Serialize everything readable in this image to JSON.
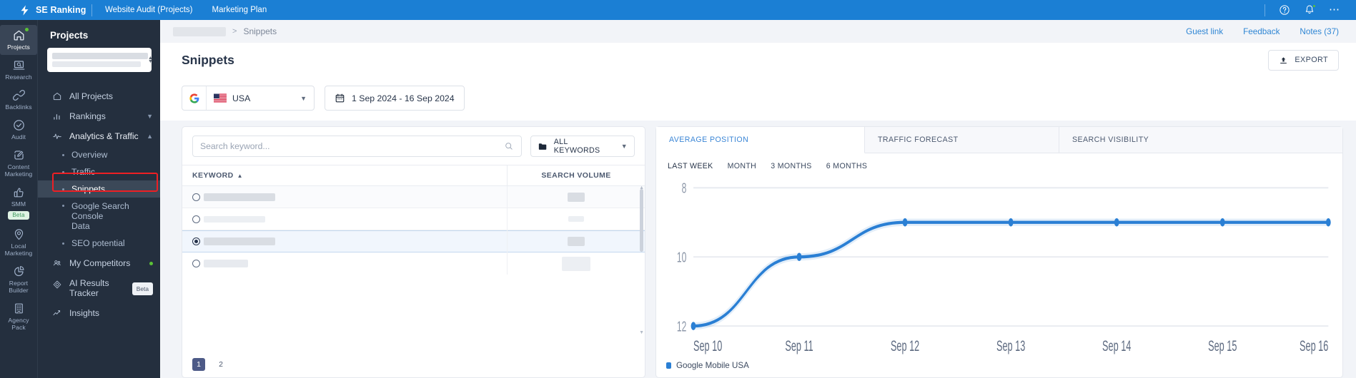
{
  "topbar": {
    "brand": "SE Ranking",
    "nav": [
      {
        "label": "Website Audit (Projects)"
      },
      {
        "label": "Marketing Plan"
      }
    ],
    "icons": {
      "help": "help-circle-icon",
      "notifications": "bell-icon",
      "more": "ellipsis-icon"
    }
  },
  "rail": {
    "items": [
      {
        "label": "Projects",
        "icon": "home-icon",
        "active": true,
        "dot": true
      },
      {
        "label": "Research",
        "icon": "research-magnifier-icon",
        "active": false,
        "dot": false
      },
      {
        "label": "Backlinks",
        "icon": "link-icon",
        "active": false,
        "dot": false
      },
      {
        "label": "Audit",
        "icon": "check-circle-icon",
        "active": false,
        "dot": false
      },
      {
        "label": "Content\nMarketing",
        "icon": "pencil-square-icon",
        "active": false,
        "dot": false
      },
      {
        "label": "SMM",
        "icon": "thumbs-up-icon",
        "active": false,
        "dot": false,
        "badge": "Beta"
      },
      {
        "label": "Local\nMarketing",
        "icon": "map-pin-icon",
        "active": false,
        "dot": false
      },
      {
        "label": "Report\nBuilder",
        "icon": "pie-chart-icon",
        "active": false,
        "dot": false
      },
      {
        "label": "Agency\nPack",
        "icon": "building-icon",
        "active": false,
        "dot": false
      }
    ],
    "labels": {
      "projects": "Projects",
      "research": "Research",
      "backlinks": "Backlinks",
      "audit": "Audit",
      "content_marketing_l1": "Content",
      "content_marketing_l2": "Marketing",
      "smm": "SMM",
      "smm_badge": "Beta",
      "local_marketing_l1": "Local",
      "local_marketing_l2": "Marketing",
      "report_builder_l1": "Report",
      "report_builder_l2": "Builder",
      "agency_pack_l1": "Agency",
      "agency_pack_l2": "Pack"
    }
  },
  "sidebar": {
    "title": "Projects",
    "project_selector_value": "",
    "nav": {
      "all_projects": "All Projects",
      "rankings": "Rankings",
      "analytics_traffic": "Analytics & Traffic",
      "overview": "Overview",
      "traffic": "Traffic",
      "snippets": "Snippets",
      "gsc_data_l1": "Google Search Console",
      "gsc_data_l2": "Data",
      "seo_potential": "SEO potential",
      "my_competitors": "My Competitors",
      "ai_results_l1": "AI Results",
      "ai_results_l2": "Tracker",
      "ai_results_badge": "Beta",
      "insights": "Insights"
    },
    "collapse_icon": "chevron-left-icon"
  },
  "breadcrumb": {
    "project_name": "",
    "separator": ">",
    "current": "Snippets",
    "links": [
      {
        "label": "Guest link"
      },
      {
        "label": "Feedback"
      },
      {
        "label": "Notes (37)"
      }
    ]
  },
  "page": {
    "title": "Snippets",
    "export_label": "EXPORT",
    "export_icon": "upload-icon"
  },
  "filters": {
    "search_engine_icon": "google-icon",
    "country_flag": "us-flag-icon",
    "country": "USA",
    "country_chevron": "chevron-down-icon",
    "date_icon": "calendar-icon",
    "date_range": "1 Sep 2024 - 16 Sep 2024"
  },
  "keywords_panel": {
    "search_placeholder": "Search keyword...",
    "search_value": "",
    "search_icon": "search-icon",
    "folder_icon": "folder-icon",
    "keyword_filter": "ALL KEYWORDS",
    "filter_chevron": "chevron-down-icon",
    "columns": {
      "keyword": "KEYWORD",
      "keyword_sort_icon": "caret-up-icon",
      "search_volume": "SEARCH VOLUME"
    },
    "rows": [
      {
        "keyword": "",
        "volume": "",
        "selected": false,
        "shade": true
      },
      {
        "keyword": "",
        "volume": "",
        "selected": false,
        "shade": false
      },
      {
        "keyword": "",
        "volume": "",
        "selected": true,
        "shade": false
      },
      {
        "keyword": "",
        "volume": "",
        "selected": false,
        "shade": false
      }
    ],
    "pagination": [
      {
        "label": "1",
        "active": true
      },
      {
        "label": "2",
        "active": false
      }
    ]
  },
  "chart_panel": {
    "tabs": [
      {
        "label": "AVERAGE POSITION",
        "active": true
      },
      {
        "label": "TRAFFIC FORECAST",
        "active": false
      },
      {
        "label": "SEARCH VISIBILITY",
        "active": false
      }
    ],
    "ranges": [
      {
        "label": "LAST WEEK",
        "active": true
      },
      {
        "label": "MONTH",
        "active": false
      },
      {
        "label": "3 MONTHS",
        "active": false
      },
      {
        "label": "6 MONTHS",
        "active": false
      }
    ],
    "legend": "Google Mobile USA",
    "accent_color": "#2a7fd4"
  },
  "chart_data": {
    "type": "line",
    "title": "Average Position",
    "xlabel": "",
    "ylabel": "",
    "x": [
      "Sep 10",
      "Sep 11",
      "Sep 12",
      "Sep 13",
      "Sep 14",
      "Sep 15",
      "Sep 16"
    ],
    "series": [
      {
        "name": "Google Mobile USA",
        "color": "#2a7fd4",
        "values": [
          12,
          10,
          9,
          9,
          9,
          9,
          9
        ]
      }
    ],
    "yticks": [
      8,
      10,
      12
    ],
    "ylim": [
      8,
      12
    ],
    "y_inverted": true,
    "grid": true,
    "legend_position": "bottom-left",
    "markers": true
  }
}
